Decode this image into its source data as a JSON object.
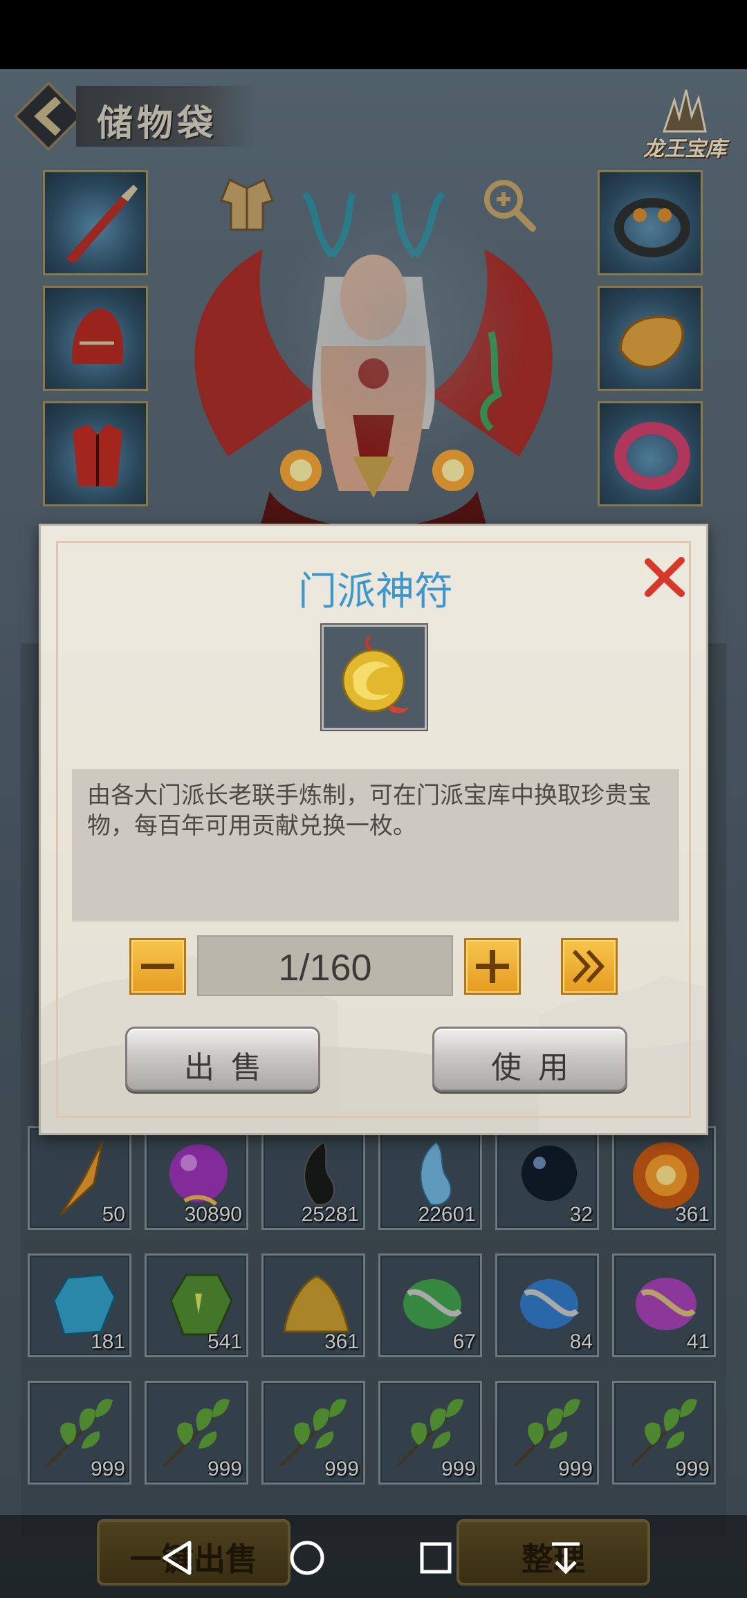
{
  "header": {
    "title": "储物袋",
    "treasury_label": "龙王宝库"
  },
  "bag": {
    "rows": [
      [
        {
          "icon": "spear-shard-icon",
          "qty": "50"
        },
        {
          "icon": "purple-orb-icon",
          "qty": "30890"
        },
        {
          "icon": "black-magatama-icon",
          "qty": "25281"
        },
        {
          "icon": "blue-magatama-icon",
          "qty": "22601"
        },
        {
          "icon": "dark-pearl-icon",
          "qty": "32"
        },
        {
          "icon": "fire-orb-icon",
          "qty": "361"
        }
      ],
      [
        {
          "icon": "blue-crystal-icon",
          "qty": "181"
        },
        {
          "icon": "green-gem-icon",
          "qty": "541"
        },
        {
          "icon": "gold-sand-icon",
          "qty": "361"
        },
        {
          "icon": "green-bundle-icon",
          "qty": "67"
        },
        {
          "icon": "blue-bundle-icon",
          "qty": "84"
        },
        {
          "icon": "purple-bundle-icon",
          "qty": "41"
        }
      ],
      [
        {
          "icon": "herb-leaf-icon",
          "qty": "999"
        },
        {
          "icon": "herb-leaf-icon",
          "qty": "999"
        },
        {
          "icon": "herb-leaf-icon",
          "qty": "999"
        },
        {
          "icon": "herb-leaf-icon",
          "qty": "999"
        },
        {
          "icon": "herb-leaf-icon",
          "qty": "999"
        },
        {
          "icon": "herb-leaf-icon",
          "qty": "999"
        }
      ]
    ]
  },
  "bottom": {
    "sell_all_label": "一键出售",
    "sort_label": "整理"
  },
  "dialog": {
    "title": "门派神符",
    "description": "由各大门派长老联手炼制，可在门派宝库中换取珍贵宝物，每百年可用贡献兑换一枚。",
    "quantity": "1/160",
    "sell_label": "出售",
    "use_label": "使用",
    "icon": "golden-talisman-icon"
  },
  "colors": {
    "title_blue": "#3d97cc",
    "close_red": "#d8382a",
    "button_gold": "#f0b33a"
  }
}
